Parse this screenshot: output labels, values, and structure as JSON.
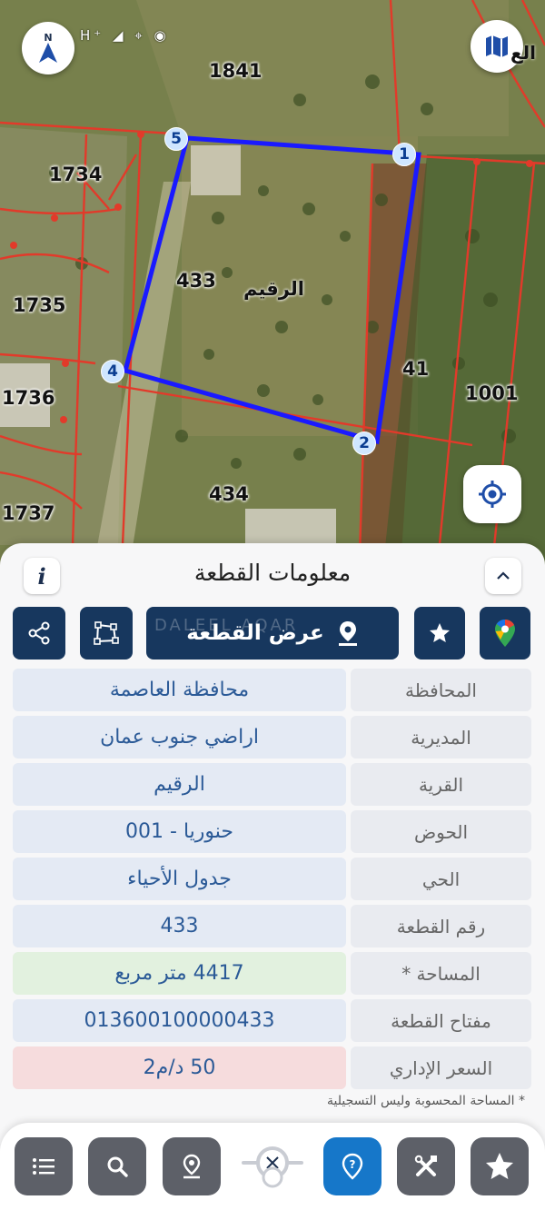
{
  "map": {
    "status": "H⁺ ◢ ⌖ ◉",
    "compass_letter": "N",
    "edge_text": "الع",
    "village_label": "الرقيم",
    "parcel_labels": [
      "1841",
      "1734",
      "433",
      "1735",
      "1736",
      "41",
      "1001",
      "434",
      "1737"
    ],
    "vertices": [
      "1",
      "2",
      "4",
      "5"
    ]
  },
  "sheet": {
    "title": "معلومات القطعة",
    "info_label": "i",
    "show_parcel_label": "عرض القطعة",
    "watermark": "DALEEL AQAR",
    "rows": [
      {
        "label": "المحافظة",
        "value": "محافظة العاصمة"
      },
      {
        "label": "المديرية",
        "value": "اراضي جنوب عمان"
      },
      {
        "label": "القرية",
        "value": "الرقيم"
      },
      {
        "label": "الحوض",
        "value": "حنوريا - 001"
      },
      {
        "label": "الحي",
        "value": "جدول الأحياء"
      },
      {
        "label": "رقم القطعة",
        "value": "433"
      },
      {
        "label": "المساحة *",
        "value": "4417  متر مربع"
      },
      {
        "label": "مفتاح القطعة",
        "value": "013600100000433"
      },
      {
        "label": "السعر الإداري",
        "value": "50 د/م2"
      }
    ],
    "footnote": "* المساحة المحسوبة وليس التسجيلية"
  },
  "colors": {
    "primary": "#17375e",
    "help": "#1677c9",
    "nav_button": "#5d6068",
    "parcel_outline": "#1a1aff",
    "parcel_lines": "#e23a2a"
  }
}
